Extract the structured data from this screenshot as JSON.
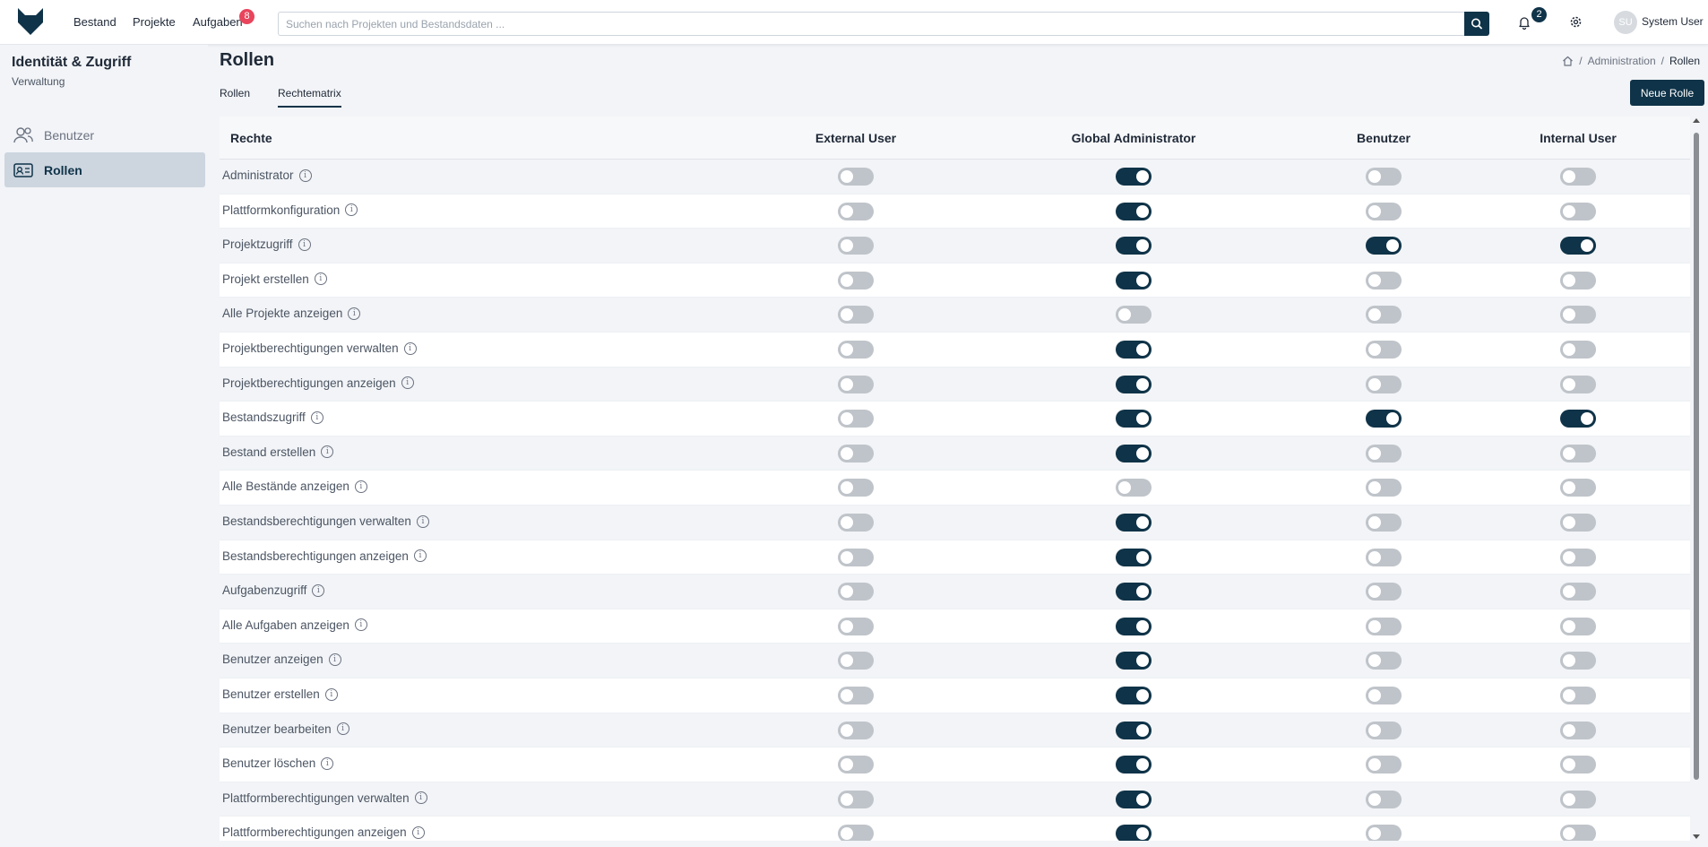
{
  "colors": {
    "accent": "#0f3348",
    "badge": "#e8455c",
    "toggle_off": "#bfc4ca"
  },
  "nav": [
    {
      "label": "Bestand"
    },
    {
      "label": "Projekte"
    },
    {
      "label": "Aufgaben",
      "badge": "8"
    }
  ],
  "search": {
    "placeholder": "Suchen nach Projekten und Bestandsdaten ..."
  },
  "notifications": {
    "count": "2"
  },
  "user": {
    "initials": "SU",
    "name": "System User"
  },
  "sidebar": {
    "title": "Identität & Zugriff",
    "subtitle": "Verwaltung",
    "items": [
      {
        "label": "Benutzer",
        "icon": "users-icon",
        "active": false
      },
      {
        "label": "Rollen",
        "icon": "id-card-icon",
        "active": true
      }
    ]
  },
  "page": {
    "title": "Rollen",
    "breadcrumb": [
      "Administration",
      "Rollen"
    ],
    "tabs": [
      {
        "label": "Rollen",
        "active": false
      },
      {
        "label": "Rechtematrix",
        "active": true
      }
    ],
    "new_button": "Neue Rolle"
  },
  "matrix": {
    "header_label": "Rechte",
    "roles": [
      "External User",
      "Global Administrator",
      "Benutzer",
      "Internal User"
    ],
    "rows": [
      {
        "name": "Administrator",
        "values": [
          false,
          true,
          false,
          false
        ]
      },
      {
        "name": "Plattformkonfiguration",
        "values": [
          false,
          true,
          false,
          false
        ]
      },
      {
        "name": "Projektzugriff",
        "values": [
          false,
          true,
          true,
          true
        ]
      },
      {
        "name": "Projekt erstellen",
        "values": [
          false,
          true,
          false,
          false
        ]
      },
      {
        "name": "Alle Projekte anzeigen",
        "values": [
          false,
          false,
          false,
          false
        ]
      },
      {
        "name": "Projektberechtigungen verwalten",
        "values": [
          false,
          true,
          false,
          false
        ]
      },
      {
        "name": "Projektberechtigungen anzeigen",
        "values": [
          false,
          true,
          false,
          false
        ]
      },
      {
        "name": "Bestandszugriff",
        "values": [
          false,
          true,
          true,
          true
        ]
      },
      {
        "name": "Bestand erstellen",
        "values": [
          false,
          true,
          false,
          false
        ]
      },
      {
        "name": "Alle Bestände anzeigen",
        "values": [
          false,
          false,
          false,
          false
        ]
      },
      {
        "name": "Bestandsberechtigungen verwalten",
        "values": [
          false,
          true,
          false,
          false
        ]
      },
      {
        "name": "Bestandsberechtigungen anzeigen",
        "values": [
          false,
          true,
          false,
          false
        ]
      },
      {
        "name": "Aufgabenzugriff",
        "values": [
          false,
          true,
          false,
          false
        ]
      },
      {
        "name": "Alle Aufgaben anzeigen",
        "values": [
          false,
          true,
          false,
          false
        ]
      },
      {
        "name": "Benutzer anzeigen",
        "values": [
          false,
          true,
          false,
          false
        ]
      },
      {
        "name": "Benutzer erstellen",
        "values": [
          false,
          true,
          false,
          false
        ]
      },
      {
        "name": "Benutzer bearbeiten",
        "values": [
          false,
          true,
          false,
          false
        ]
      },
      {
        "name": "Benutzer löschen",
        "values": [
          false,
          true,
          false,
          false
        ]
      },
      {
        "name": "Plattformberechtigungen verwalten",
        "values": [
          false,
          true,
          false,
          false
        ]
      },
      {
        "name": "Plattformberechtigungen anzeigen",
        "values": [
          false,
          true,
          false,
          false
        ]
      }
    ]
  }
}
